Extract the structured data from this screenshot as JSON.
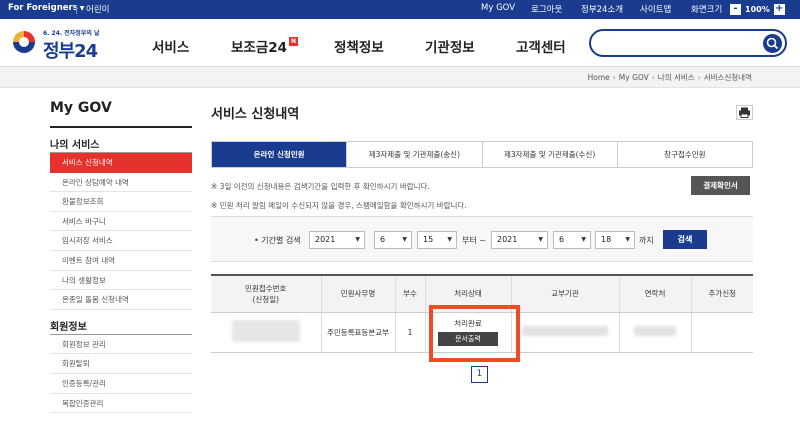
{
  "topbar": {
    "lang": "For Foreigners",
    "kids": "어린이",
    "util": [
      "My GOV",
      "로그아웃",
      "정부24소개",
      "사이트맵",
      "화면크기"
    ],
    "zoom_minus": "-",
    "zoom_value": "100%",
    "zoom_plus": "+"
  },
  "header": {
    "logo_tag": "6. 24. 전자정부의 날",
    "logo_name": "정부24",
    "gnb": [
      "서비스",
      "보조금24",
      "정책정보",
      "기관정보",
      "고객센터"
    ],
    "new_badge": "N",
    "search_placeholder": ""
  },
  "breadcrumb": [
    "Home",
    "My GOV",
    "나의 서비스",
    "서비스신청내역"
  ],
  "lnb": {
    "title": "My GOV",
    "group1": "나의 서비스",
    "items1": [
      "서비스 신청내역",
      "온라인 상담예약 내역",
      "환불정보조회",
      "서비스 바구니",
      "임시저장 서비스",
      "이벤트 참여 내역",
      "나의 생활정보",
      "온종일 돌봄 신청내역"
    ],
    "group2": "회원정보",
    "items2": [
      "회원정보 관리",
      "회원탈퇴",
      "인증등록/관리",
      "복합인증관리"
    ]
  },
  "main": {
    "title": "서비스 신청내역",
    "tabs": [
      "온라인 신청민원",
      "제3자제출 및 기관제출(송신)",
      "제3자제출 및 기관제출(수신)",
      "창구접수민원"
    ],
    "note1": "※ 3일 이전의 신청내용은 검색기간을 입력한 후 확인하시기 바랍니다.",
    "note2": "※ 민원 처리 알림 메일이 수신되지 않을 경우, 스팸메일함을 확인하시기 바랍니다.",
    "confirm_btn": "결제확인서",
    "period_label": "• 기간별 검색",
    "from_year": "2021",
    "from_month": "6",
    "from_day": "15",
    "from_text": "부터 ~",
    "to_year": "2021",
    "to_month": "6",
    "to_day": "18",
    "to_text": "까지",
    "search_btn": "검색",
    "columns": [
      "민원접수번호\n(신청일)",
      "민원사무명",
      "부수",
      "처리상태",
      "교부기관",
      "연락처",
      "추가신청"
    ],
    "row": {
      "service": "주민등록표등본교부",
      "copies": "1",
      "status": "처리완료",
      "doc_btn": "문서출력"
    },
    "page": "1"
  }
}
